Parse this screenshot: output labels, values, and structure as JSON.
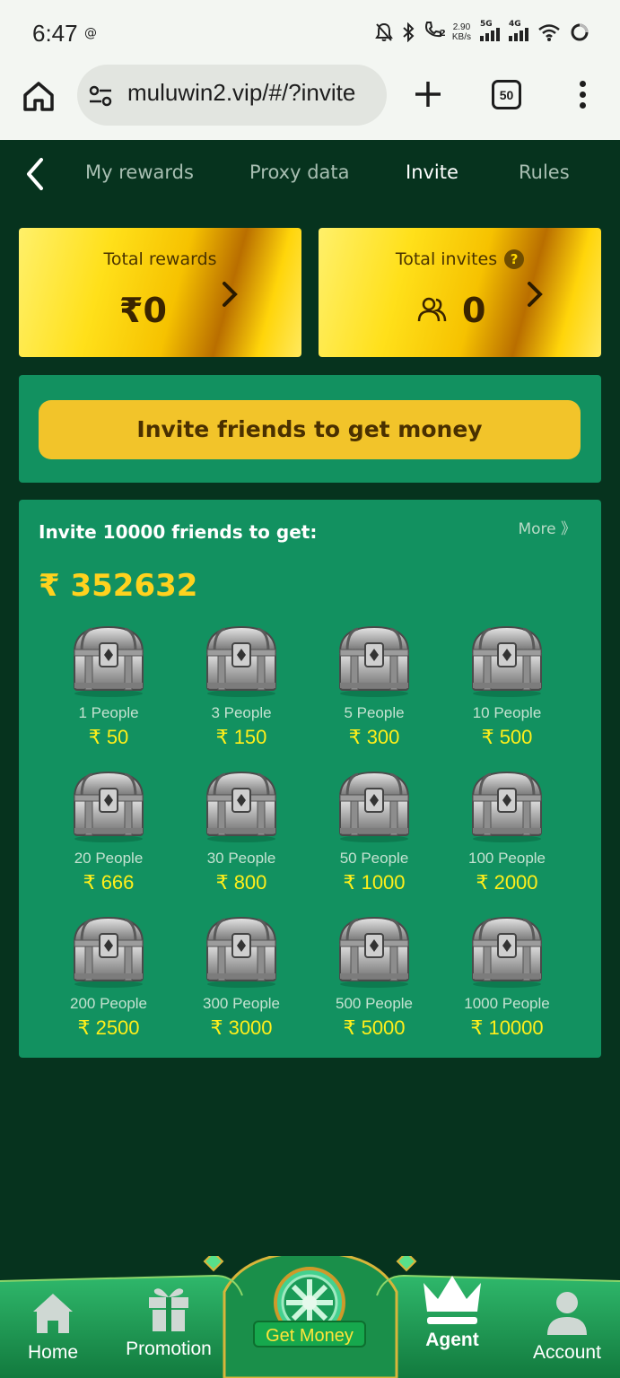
{
  "status_bar": {
    "time": "6:47",
    "net_speed_value": "2.90",
    "net_speed_unit": "KB/s",
    "sim1_label": "5G",
    "sim2_label": "4G",
    "call_sim": "2",
    "icons": [
      "threads-icon",
      "bell-off-icon",
      "bluetooth-icon",
      "wifi-call-icon",
      "signal-icon",
      "wifi-icon",
      "battery-icon"
    ]
  },
  "browser": {
    "url": "muluwin2.vip/#/?invite",
    "tab_count": "50"
  },
  "nav": {
    "tabs": [
      {
        "label": "My rewards",
        "active": false
      },
      {
        "label": "Proxy data",
        "active": false
      },
      {
        "label": "Invite",
        "active": true
      },
      {
        "label": "Rules",
        "active": false
      }
    ]
  },
  "stats": {
    "total_rewards_label": "Total rewards",
    "total_rewards_value": "₹0",
    "total_invites_label": "Total invites",
    "total_invites_value": "0"
  },
  "invite": {
    "button_label": "Invite friends to get money"
  },
  "rewards": {
    "title": "Invite 10000 friends to get:",
    "more_label": "More 》",
    "total": "₹ 352632",
    "tiers": [
      {
        "label": "1 People",
        "amount": "₹ 50"
      },
      {
        "label": "3 People",
        "amount": "₹ 150"
      },
      {
        "label": "5 People",
        "amount": "₹ 300"
      },
      {
        "label": "10 People",
        "amount": "₹ 500"
      },
      {
        "label": "20 People",
        "amount": "₹ 666"
      },
      {
        "label": "30 People",
        "amount": "₹ 800"
      },
      {
        "label": "50 People",
        "amount": "₹ 1000"
      },
      {
        "label": "100 People",
        "amount": "₹ 2000"
      },
      {
        "label": "200 People",
        "amount": "₹ 2500"
      },
      {
        "label": "300 People",
        "amount": "₹ 3000"
      },
      {
        "label": "500 People",
        "amount": "₹ 5000"
      },
      {
        "label": "1000 People",
        "amount": "₹ 10000"
      }
    ]
  },
  "bottom_nav": {
    "items": [
      {
        "label": "Home",
        "icon": "house-icon"
      },
      {
        "label": "Promotion",
        "icon": "gift-icon"
      },
      {
        "label": "Get Money",
        "icon": "wheel-icon"
      },
      {
        "label": "Agent",
        "icon": "crown-icon",
        "active": true
      },
      {
        "label": "Account",
        "icon": "person-icon"
      }
    ]
  },
  "colors": {
    "page_bg": "#06331e",
    "panel_bg": "#129160",
    "gold": "#ffd21e",
    "button_gold": "#f2c42a",
    "nav_green": "#1c9a55"
  }
}
